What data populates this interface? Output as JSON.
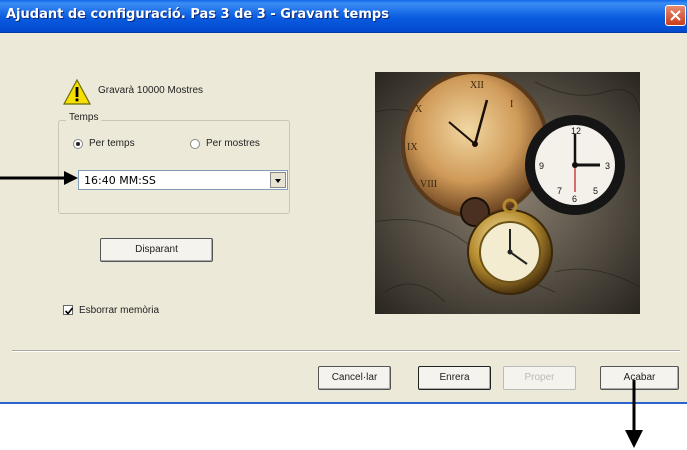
{
  "window": {
    "title": "Ajudant de configuració. Pas 3 de 3 - Gravant temps"
  },
  "warning": {
    "icon": "warning-icon",
    "text": "Gravarà 10000 Mostres"
  },
  "temps_group": {
    "label": "Temps",
    "options": [
      {
        "label": "Per temps",
        "checked": true
      },
      {
        "label": "Per mostres",
        "checked": false
      }
    ],
    "combo_value": "16:40 MM:SS"
  },
  "trigger_button": {
    "label": "Disparant"
  },
  "erase_memory": {
    "label": "Esborrar memòria",
    "checked": true
  },
  "buttons": {
    "cancel": "Cancel·lar",
    "back": "Enrera",
    "next": "Proper",
    "finish": "Acabar"
  },
  "colors": {
    "title_bar": "#0a5ce0",
    "window_bg": "#ece9d8",
    "close_button": "#c93d1c"
  }
}
